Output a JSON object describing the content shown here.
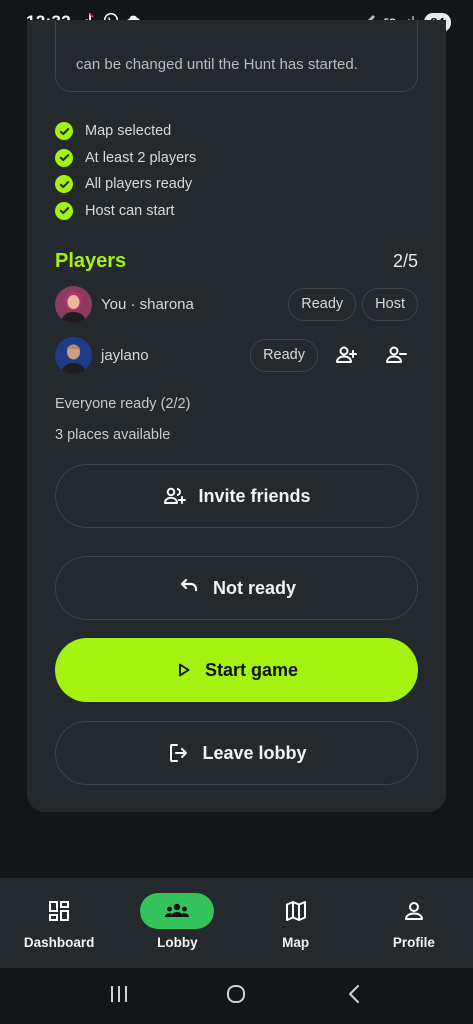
{
  "status_bar": {
    "time": "12:32",
    "battery": "84",
    "network": "5G"
  },
  "info_text": "can be changed until the Hunt has started.",
  "checklist": [
    "Map selected",
    "At least 2 players",
    "All players ready",
    "Host can start"
  ],
  "players": {
    "title": "Players",
    "count": "2/5",
    "list": [
      {
        "name": "You · sharona",
        "tags": [
          "Ready",
          "Host"
        ]
      },
      {
        "name": "jaylano",
        "tags": [
          "Ready"
        ]
      }
    ]
  },
  "status": {
    "ready": "Everyone ready (2/2)",
    "places": "3 places available"
  },
  "buttons": {
    "invite": "Invite friends",
    "not_ready": "Not ready",
    "start": "Start game",
    "leave": "Leave lobby"
  },
  "nav": [
    {
      "label": "Dashboard",
      "icon": "dashboard-icon"
    },
    {
      "label": "Lobby",
      "icon": "group-icon",
      "active": true
    },
    {
      "label": "Map",
      "icon": "map-icon"
    },
    {
      "label": "Profile",
      "icon": "person-icon"
    }
  ],
  "colors": {
    "accent": "#a3f20f",
    "active_nav": "#33c35a",
    "card": "#24292d",
    "background": "#121619"
  }
}
